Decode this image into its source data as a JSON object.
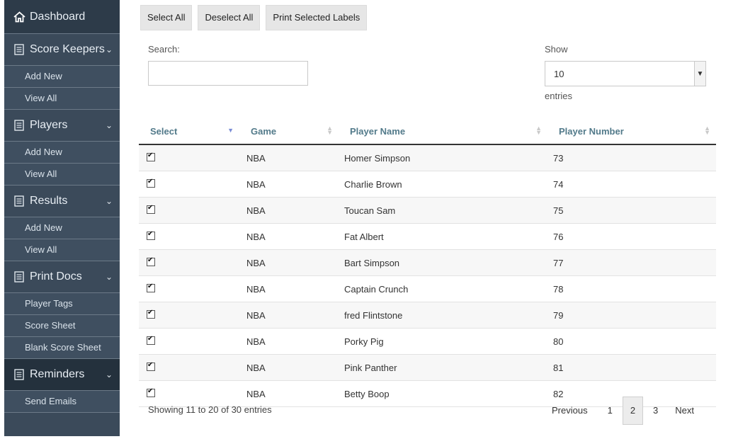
{
  "sidebar": {
    "dashboard": "Dashboard",
    "sections": [
      {
        "title": "Score Keepers",
        "items": [
          "Add New",
          "View All"
        ]
      },
      {
        "title": "Players",
        "items": [
          "Add New",
          "View All"
        ]
      },
      {
        "title": "Results",
        "items": [
          "Add New",
          "View All"
        ]
      },
      {
        "title": "Print Docs",
        "items": [
          "Player Tags",
          "Score Sheet",
          "Blank Score Sheet"
        ]
      },
      {
        "title": "Reminders",
        "items": [
          "Send Emails"
        ]
      }
    ]
  },
  "toolbar": {
    "select_all": "Select All",
    "deselect_all": "Deselect All",
    "print_labels": "Print Selected Labels"
  },
  "search": {
    "label": "Search:",
    "value": ""
  },
  "length": {
    "show": "Show",
    "value": "10",
    "entries": "entries"
  },
  "table": {
    "headers": [
      "Select",
      "Game",
      "Player Name",
      "Player Number"
    ],
    "rows": [
      {
        "checked": true,
        "game": "NBA",
        "name": "Homer Simpson",
        "number": "73"
      },
      {
        "checked": true,
        "game": "NBA",
        "name": "Charlie Brown",
        "number": "74"
      },
      {
        "checked": true,
        "game": "NBA",
        "name": "Toucan Sam",
        "number": "75"
      },
      {
        "checked": true,
        "game": "NBA",
        "name": "Fat Albert",
        "number": "76"
      },
      {
        "checked": true,
        "game": "NBA",
        "name": "Bart Simpson",
        "number": "77"
      },
      {
        "checked": true,
        "game": "NBA",
        "name": "Captain Crunch",
        "number": "78"
      },
      {
        "checked": true,
        "game": "NBA",
        "name": "fred Flintstone",
        "number": "79"
      },
      {
        "checked": true,
        "game": "NBA",
        "name": "Porky Pig",
        "number": "80"
      },
      {
        "checked": true,
        "game": "NBA",
        "name": "Pink Panther",
        "number": "81"
      },
      {
        "checked": true,
        "game": "NBA",
        "name": "Betty Boop",
        "number": "82"
      }
    ]
  },
  "info": "Showing 11 to 20 of 30 entries",
  "pagination": {
    "previous": "Previous",
    "pages": [
      "1",
      "2",
      "3"
    ],
    "current": "2",
    "next": "Next"
  }
}
